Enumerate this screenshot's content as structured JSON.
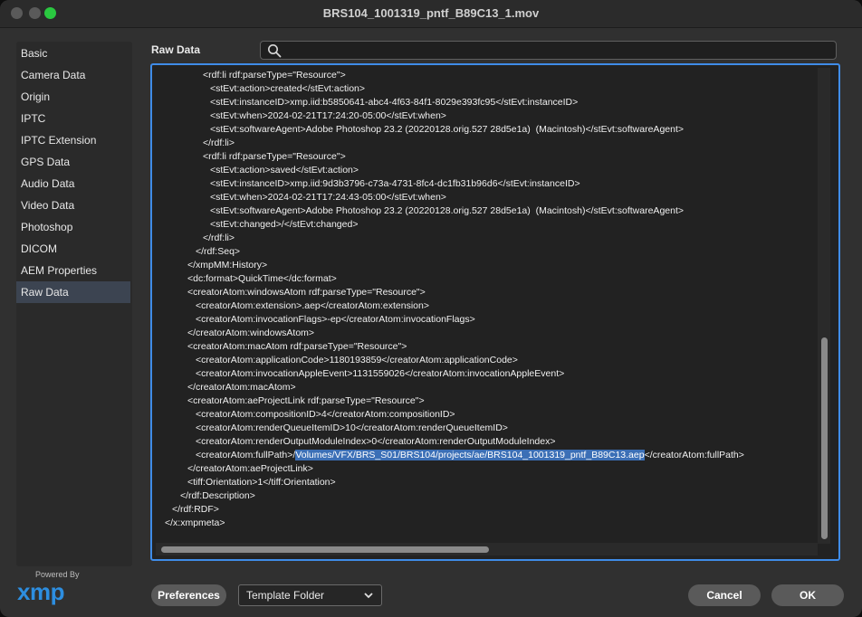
{
  "window": {
    "title": "BRS104_1001319_pntf_B89C13_1.mov"
  },
  "sidebar": {
    "items": [
      {
        "label": "Basic"
      },
      {
        "label": "Camera Data"
      },
      {
        "label": "Origin"
      },
      {
        "label": "IPTC"
      },
      {
        "label": "IPTC Extension"
      },
      {
        "label": "GPS Data"
      },
      {
        "label": "Audio Data"
      },
      {
        "label": "Video Data"
      },
      {
        "label": "Photoshop"
      },
      {
        "label": "DICOM"
      },
      {
        "label": "AEM Properties"
      },
      {
        "label": "Raw Data"
      }
    ],
    "active": "Raw Data"
  },
  "main": {
    "section_label": "Raw Data",
    "search": {
      "value": "",
      "placeholder": ""
    },
    "raw_lines": [
      {
        "indent": 224,
        "text": "<rdf:li rdf:parseType=\"Resource\">"
      },
      {
        "indent": 232,
        "text": "<stEvt:action>created</stEvt:action>"
      },
      {
        "indent": 232,
        "text": "<stEvt:instanceID>xmp.iid:b5850641-abc4-4f63-84f1-8029e393fc95</stEvt:instanceID>"
      },
      {
        "indent": 232,
        "text": "<stEvt:when>2024-02-21T17:24:20-05:00</stEvt:when>"
      },
      {
        "indent": 232,
        "text": "<stEvt:softwareAgent>Adobe Photoshop 23.2 (20220128.orig.527 28d5e1a)  (Macintosh)</stEvt:softwareAgent>"
      },
      {
        "indent": 224,
        "text": "</rdf:li>"
      },
      {
        "indent": 224,
        "text": "<rdf:li rdf:parseType=\"Resource\">"
      },
      {
        "indent": 232,
        "text": "<stEvt:action>saved</stEvt:action>"
      },
      {
        "indent": 232,
        "text": "<stEvt:instanceID>xmp.iid:9d3b3796-c73a-4731-8fc4-dc1fb31b96d6</stEvt:instanceID>"
      },
      {
        "indent": 232,
        "text": "<stEvt:when>2024-02-21T17:24:43-05:00</stEvt:when>"
      },
      {
        "indent": 232,
        "text": "<stEvt:softwareAgent>Adobe Photoshop 23.2 (20220128.orig.527 28d5e1a)  (Macintosh)</stEvt:softwareAgent>"
      },
      {
        "indent": 232,
        "text": "<stEvt:changed>/</stEvt:changed>"
      },
      {
        "indent": 224,
        "text": "</rdf:li>"
      },
      {
        "indent": 216,
        "text": "</rdf:Seq>"
      },
      {
        "indent": 207,
        "text": "</xmpMM:History>"
      },
      {
        "indent": 207,
        "text": "<dc:format>QuickTime</dc:format>"
      },
      {
        "indent": 207,
        "text": "<creatorAtom:windowsAtom rdf:parseType=\"Resource\">"
      },
      {
        "indent": 216,
        "text": "<creatorAtom:extension>.aep</creatorAtom:extension>"
      },
      {
        "indent": 216,
        "text": "<creatorAtom:invocationFlags>-ep</creatorAtom:invocationFlags>"
      },
      {
        "indent": 207,
        "text": "</creatorAtom:windowsAtom>"
      },
      {
        "indent": 207,
        "text": "<creatorAtom:macAtom rdf:parseType=\"Resource\">"
      },
      {
        "indent": 216,
        "text": "<creatorAtom:applicationCode>1180193859</creatorAtom:applicationCode>"
      },
      {
        "indent": 216,
        "text": "<creatorAtom:invocationAppleEvent>1131559026</creatorAtom:invocationAppleEvent>"
      },
      {
        "indent": 207,
        "text": "</creatorAtom:macAtom>"
      },
      {
        "indent": 207,
        "text": "<creatorAtom:aeProjectLink rdf:parseType=\"Resource\">"
      },
      {
        "indent": 216,
        "text": "<creatorAtom:compositionID>4</creatorAtom:compositionID>"
      },
      {
        "indent": 216,
        "text": "<creatorAtom:renderQueueItemID>10</creatorAtom:renderQueueItemID>"
      },
      {
        "indent": 216,
        "text": "<creatorAtom:renderOutputModuleIndex>0</creatorAtom:renderOutputModuleIndex>"
      },
      {
        "indent": 216,
        "text": "<creatorAtom:fullPath>/",
        "selected": "Volumes/VFX/BRS_S01/BRS104/projects/ae/BRS104_1001319_pntf_B89C13.aep",
        "after": "</creatorAtom:fullPath>"
      },
      {
        "indent": 207,
        "text": "</creatorAtom:aeProjectLink>"
      },
      {
        "indent": 207,
        "text": "<tiff:Orientation>1</tiff:Orientation>"
      },
      {
        "indent": 199,
        "text": "</rdf:Description>"
      },
      {
        "indent": 190,
        "text": "</rdf:RDF>"
      },
      {
        "indent": 182,
        "text": "</x:xmpmeta>"
      }
    ]
  },
  "footer": {
    "powered_by": "Powered By",
    "logo": "xmp",
    "preferences_label": "Preferences",
    "template_select": {
      "value": "Template Folder"
    },
    "cancel_label": "Cancel",
    "ok_label": "OK"
  },
  "colors": {
    "accent": "#3f8ce8",
    "selection": "#3b6fb6",
    "traffic_green": "#2ac840",
    "xmp_logo": "#2d8ee0"
  },
  "icons": [
    "search-icon",
    "chevron-down-icon",
    "xmp-logo"
  ]
}
